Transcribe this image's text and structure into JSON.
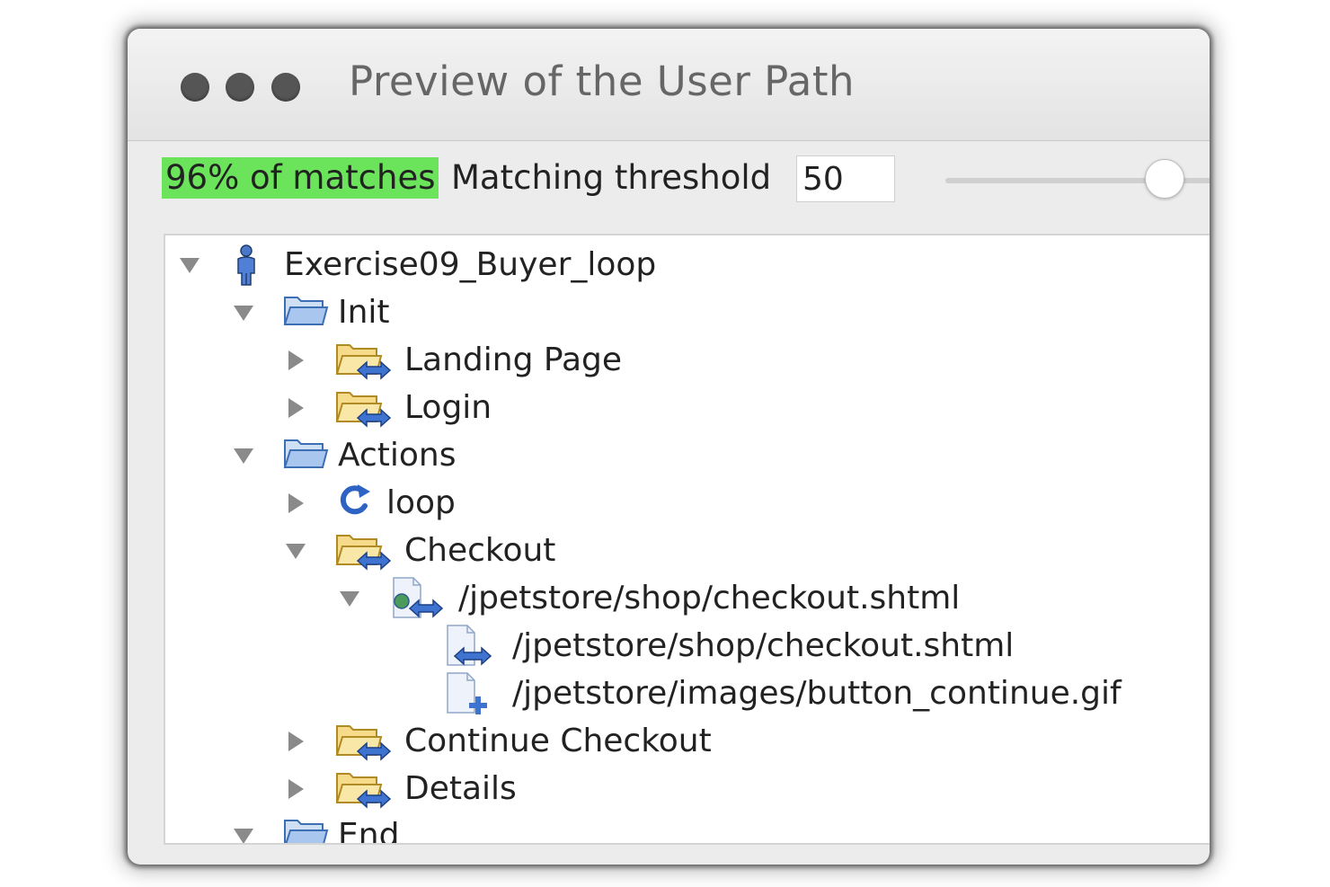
{
  "window": {
    "title": "Preview of the User Path"
  },
  "toolbar": {
    "matches_label": "96% of matches",
    "matches_color": "#6be35a",
    "threshold_label": "Matching threshold",
    "threshold_value": "50",
    "slider_value": 50
  },
  "tree": {
    "items": [
      {
        "label": "Exercise09_Buyer_loop",
        "icon": "user-icon",
        "expanded": true
      },
      {
        "label": "Init",
        "icon": "folder-open-icon",
        "expanded": true
      },
      {
        "label": "Landing Page",
        "icon": "page-folder-icon",
        "expanded": false
      },
      {
        "label": "Login",
        "icon": "page-folder-icon",
        "expanded": false
      },
      {
        "label": "Actions",
        "icon": "folder-open-icon",
        "expanded": true
      },
      {
        "label": "loop",
        "icon": "loop-icon",
        "expanded": false
      },
      {
        "label": "Checkout",
        "icon": "page-folder-icon",
        "expanded": true
      },
      {
        "label": "/jpetstore/shop/checkout.shtml",
        "icon": "web-page-icon",
        "expanded": true
      },
      {
        "label": "/jpetstore/shop/checkout.shtml",
        "icon": "request-icon"
      },
      {
        "label": "/jpetstore/images/button_continue.gif",
        "icon": "resource-icon"
      },
      {
        "label": "Continue Checkout",
        "icon": "page-folder-icon",
        "expanded": false
      },
      {
        "label": "Details",
        "icon": "page-folder-icon",
        "expanded": false
      },
      {
        "label": "End",
        "icon": "folder-open-icon",
        "expanded": true
      }
    ]
  }
}
